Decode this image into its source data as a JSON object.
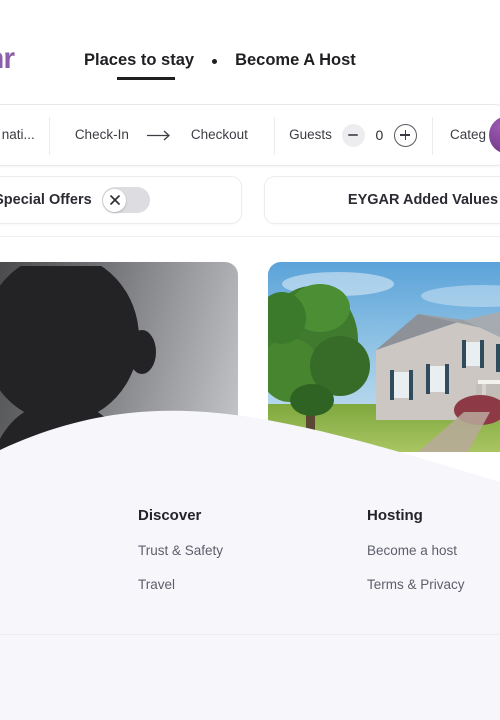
{
  "brand": {
    "logo_text": "nr",
    "logo_color": "#8c5fa8"
  },
  "nav": {
    "items": [
      {
        "label": "Places to stay",
        "active": true
      },
      {
        "label": "Become A Host",
        "active": false
      }
    ],
    "separator_icon": "dot-separator-icon"
  },
  "search": {
    "destination": {
      "value": "nati...",
      "icon": "destination-field"
    },
    "checkin": {
      "label": "Check-In"
    },
    "dates_arrow_icon": "arrow-right-icon",
    "checkout": {
      "label": "Checkout"
    },
    "guests": {
      "label": "Guests",
      "count": "0",
      "decrement_icon": "minus-icon",
      "increment_icon": "plus-icon"
    },
    "category": {
      "label": "Categ",
      "chevron_icon": "chevron-down-icon"
    },
    "avatar": {
      "icon": "user-avatar",
      "color": "#7b3f8f"
    }
  },
  "filters": {
    "monthly_offers": {
      "label": "thly Special Offers",
      "toggle_state": "off",
      "knob_icon": "close-x-icon"
    },
    "eygar": {
      "label": "EYGAR Added Values"
    }
  },
  "cards": [
    {
      "name": "profile-placeholder-card",
      "icon": "person-silhouette"
    },
    {
      "name": "property-photo-card",
      "icon": "house-photo"
    }
  ],
  "footer": {
    "columns": [
      {
        "title": "Discover",
        "links": [
          "Trust & Safety",
          "Travel"
        ]
      },
      {
        "title": "Hosting",
        "links": [
          "Become a host",
          "Terms & Privacy"
        ]
      }
    ],
    "background_color": "#f6f6fb"
  }
}
